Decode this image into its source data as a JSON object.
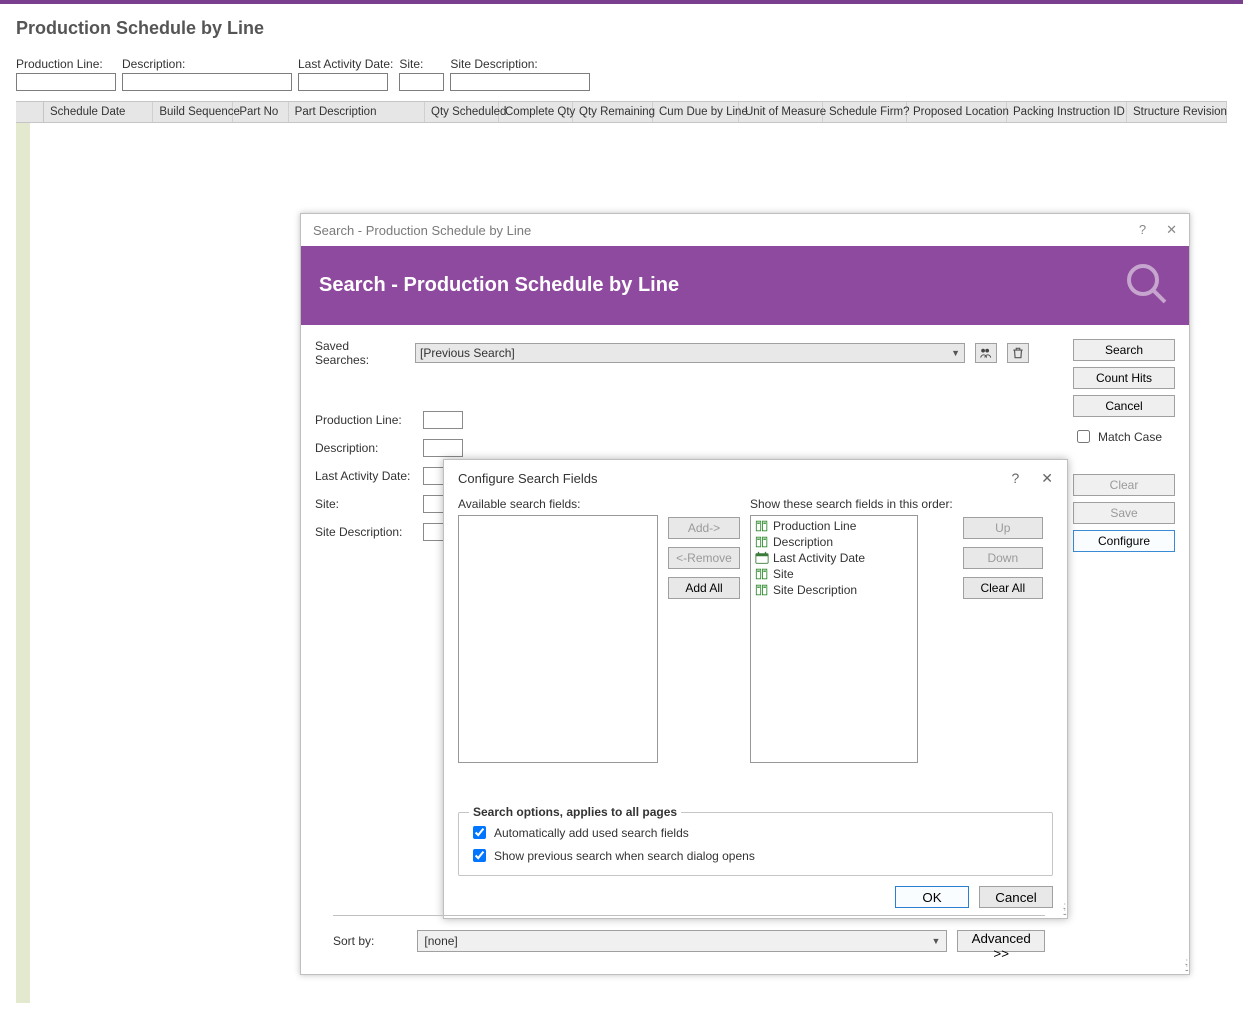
{
  "page": {
    "title": "Production Schedule by Line",
    "filters": {
      "productionLine": {
        "label": "Production Line:",
        "value": ""
      },
      "description": {
        "label": "Description:",
        "value": ""
      },
      "lastActivityDate": {
        "label": "Last Activity Date:",
        "value": ""
      },
      "site": {
        "label": "Site:",
        "value": ""
      },
      "siteDescription": {
        "label": "Site Description:",
        "value": ""
      }
    },
    "gridColumns": [
      "Schedule Date",
      "Build Sequence",
      "Part No",
      "Part Description",
      "Qty Scheduled",
      "Complete Qty",
      "Qty Remaining",
      "Cum Due by Line",
      "Unit of Measure",
      "Schedule Firm?",
      "Proposed Location",
      "Packing Instruction ID",
      "Structure Revision"
    ]
  },
  "searchDialog": {
    "windowTitle": "Search - Production Schedule by Line",
    "bannerTitle": "Search - Production Schedule by Line",
    "savedSearchesLabel": "Saved Searches:",
    "savedSearchesValue": "[Previous Search]",
    "fieldLabels": {
      "productionLine": "Production Line:",
      "description": "Description:",
      "lastActivityDate": "Last Activity Date:",
      "site": "Site:",
      "siteDescription": "Site Description:"
    },
    "sideButtons": {
      "search": "Search",
      "countHits": "Count Hits",
      "cancel": "Cancel",
      "matchCase": "Match Case",
      "clear": "Clear",
      "save": "Save",
      "configure": "Configure"
    },
    "sortByLabel": "Sort by:",
    "sortByValue": "[none]",
    "advancedBtn": "Advanced >>"
  },
  "configDialog": {
    "title": "Configure Search Fields",
    "availableLabel": "Available search fields:",
    "orderedLabel": "Show these search fields in this order:",
    "availableFields": [],
    "orderedFields": [
      {
        "name": "Production Line",
        "type": "text"
      },
      {
        "name": "Description",
        "type": "text"
      },
      {
        "name": "Last Activity Date",
        "type": "date"
      },
      {
        "name": "Site",
        "type": "text"
      },
      {
        "name": "Site Description",
        "type": "text"
      }
    ],
    "btns": {
      "add": "Add->",
      "remove": "<-Remove",
      "addAll": "Add All",
      "up": "Up",
      "down": "Down",
      "clearAll": "Clear All",
      "ok": "OK",
      "cancel": "Cancel"
    },
    "optionsTitle": "Search options, applies to all pages",
    "autoAddLabel": "Automatically add used search fields",
    "autoAddChecked": true,
    "showPrevLabel": "Show previous search when search dialog opens",
    "showPrevChecked": true
  }
}
